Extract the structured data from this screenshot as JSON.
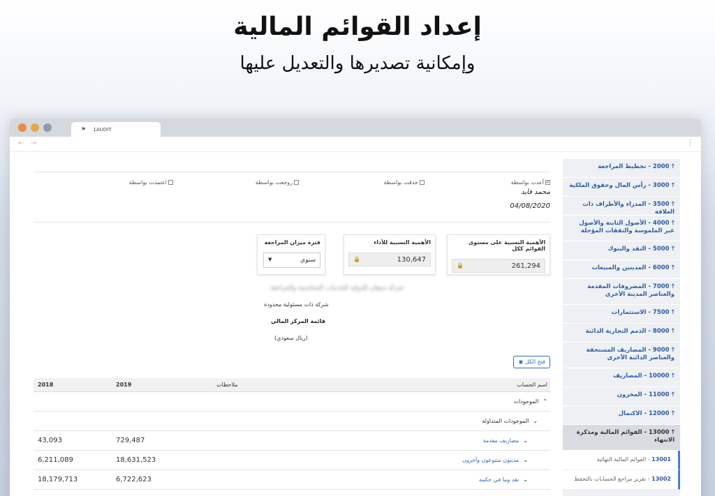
{
  "promo": {
    "title": "إعداد القوائم المالية",
    "subtitle": "وإمكانية تصديرها والتعديل عليها"
  },
  "browser": {
    "tab_title": "1AUDIT"
  },
  "signoff": {
    "prepared_by": "أعدت بواسطة",
    "checked_by": "خدقت بواسطة",
    "reviewed_by": "روجعت بواسطة",
    "approved_by": "اعتمدت بواسطة",
    "preparer_name": "محمد فايد",
    "prepared_date": "04/08/2020"
  },
  "materiality": {
    "overall_label": "الأهمية النسبية على مستوى القوائم ككل",
    "overall_value": "261,294",
    "performance_label": "الأهمية النسبية للأداء",
    "performance_value": "130,647",
    "period_label": "فترة ميزان المراجعة",
    "period_value": "سنوي"
  },
  "statement": {
    "company_name": "شركة سيفان للدولية للخدمات المحاسبية والمراجعة",
    "company_type": "شركة ذات مسئولية محدودة",
    "title": "قائمة المركز المالي",
    "currency": "(ريال سعودي)",
    "open_all_label": "فتح الكل"
  },
  "table": {
    "headers": {
      "account": "اسم الحساب",
      "notes": "ملاحظات",
      "y2019": "2019",
      "y2018": "2018"
    },
    "rows": [
      {
        "account": "الموجودات",
        "v2019": "",
        "v2018": ""
      },
      {
        "account": "الموجودات المتداولة",
        "v2019": "",
        "v2018": ""
      },
      {
        "account": "مصاريف مقدمة",
        "v2019": "729,487",
        "v2018": "43,093"
      },
      {
        "account": "مدينون متنوعون وآخرون",
        "v2019": "18,631,523",
        "v2018": "6,211,089"
      },
      {
        "account": "نقد وما في حكمه",
        "v2019": "6,722,623",
        "v2018": "18,179,713"
      }
    ]
  },
  "sidebar": {
    "items": [
      {
        "label": "2000 - تخطيط المراجعة"
      },
      {
        "label": "3000 - رأس المال وحقوق الملكية"
      },
      {
        "label": "3500 - المدراء والأطراف ذات العلاقة"
      },
      {
        "label": "4000 - الأصول الثابتة والأصول غير الملموسة والنفقات المؤجلة"
      },
      {
        "label": "5000 - النقد والبنوك"
      },
      {
        "label": "6000 - المدينين والمبيعات"
      },
      {
        "label": "7000 - المصروفات المقدمة والعناصر المدينة الأخرى"
      },
      {
        "label": "7500 - الاستثمارات"
      },
      {
        "label": "8000 - الذمم التجارية الدائنة"
      },
      {
        "label": "9000 - المصاريف المستحقة والعناصر الدائنة الأخرى"
      },
      {
        "label": "10000 - المصاريف"
      },
      {
        "label": "11000 - المخزون"
      },
      {
        "label": "12000 - الاكتمال"
      },
      {
        "label": "13000 - القوائم المالية ومذكرة الانتهاء"
      }
    ],
    "subitems": [
      {
        "num": "13001",
        "label": "القوائم المالية النهائية"
      },
      {
        "num": "13002",
        "label": "تقرير مراجع الحسابات بالتحفظ"
      }
    ]
  },
  "colors": {
    "accent": "#2b5ca8",
    "link": "#2e6cb5",
    "sidebar_bg": "#eef0f3"
  }
}
